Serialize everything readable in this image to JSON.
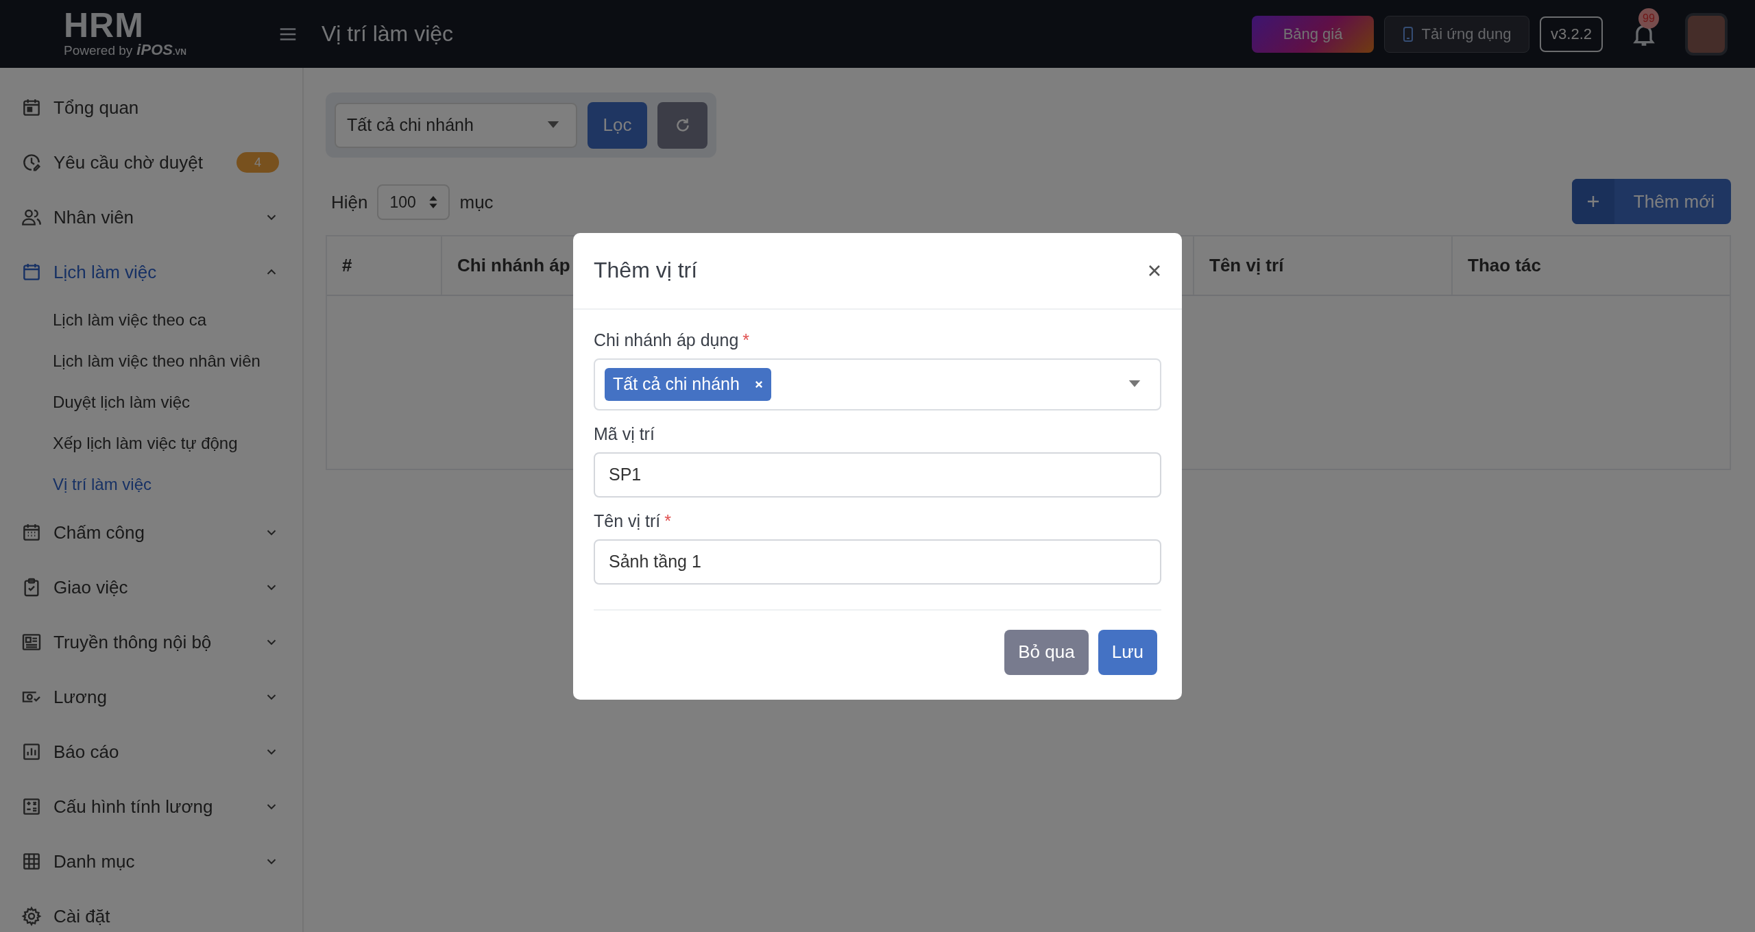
{
  "header": {
    "logo": {
      "title": "HRM",
      "powered_by": "Powered by",
      "brand": "iPOS",
      "brand_suffix": ".VN"
    },
    "page_title": "Vị trí làm việc",
    "pricing_button": "Bảng giá",
    "app_button": "Tải ứng dụng",
    "version": "v3.2.2",
    "notification_count": "99"
  },
  "sidebar": {
    "items": [
      {
        "label": "Tổng quan",
        "selected": false
      },
      {
        "label": "Yêu cầu chờ duyệt",
        "selected": false,
        "badge": "4"
      },
      {
        "label": "Nhân viên",
        "selected": false,
        "expanded": false
      },
      {
        "label": "Lịch làm việc",
        "selected": true,
        "expanded": true,
        "children": [
          {
            "label": "Lịch làm việc theo ca",
            "selected": false
          },
          {
            "label": "Lịch làm việc theo nhân viên",
            "selected": false
          },
          {
            "label": "Duyệt lịch làm việc",
            "selected": false
          },
          {
            "label": "Xếp lịch làm việc tự động",
            "selected": false
          },
          {
            "label": "Vị trí làm việc",
            "selected": true
          }
        ]
      },
      {
        "label": "Chấm công",
        "selected": false,
        "expanded": false
      },
      {
        "label": "Giao việc",
        "selected": false,
        "expanded": false
      },
      {
        "label": "Truyền thông nội bộ",
        "selected": false,
        "expanded": false
      },
      {
        "label": "Lương",
        "selected": false,
        "expanded": false
      },
      {
        "label": "Báo cáo",
        "selected": false,
        "expanded": false
      },
      {
        "label": "Cấu hình tính lương",
        "selected": false,
        "expanded": false
      },
      {
        "label": "Danh mục",
        "selected": false,
        "expanded": false
      },
      {
        "label": "Cài đặt",
        "selected": false
      }
    ]
  },
  "filter": {
    "branch_select": "Tất cả chi nhánh",
    "filter_button": "Lọc"
  },
  "page_size": {
    "prefix": "Hiện",
    "value": "100",
    "suffix": "mục"
  },
  "add_button": "Thêm mới",
  "table": {
    "columns": [
      "#",
      "Chi nhánh áp",
      "Tên vị trí",
      "Thao tác"
    ]
  },
  "modal": {
    "title": "Thêm vị trí",
    "fields": [
      {
        "label": "Chi nhánh áp dụng",
        "required_mark": "*",
        "kind": "multiselect",
        "tags": [
          "Tất cả chi nhánh"
        ]
      },
      {
        "label": "Mã vị trí",
        "kind": "text",
        "value": "SP1"
      },
      {
        "label": "Tên vị trí",
        "required_mark": "*",
        "kind": "text",
        "value": "Sảnh tầng 1"
      }
    ],
    "buttons": [
      {
        "label": "Bỏ qua",
        "kind": "secondary"
      },
      {
        "label": "Lưu",
        "kind": "primary"
      }
    ]
  }
}
